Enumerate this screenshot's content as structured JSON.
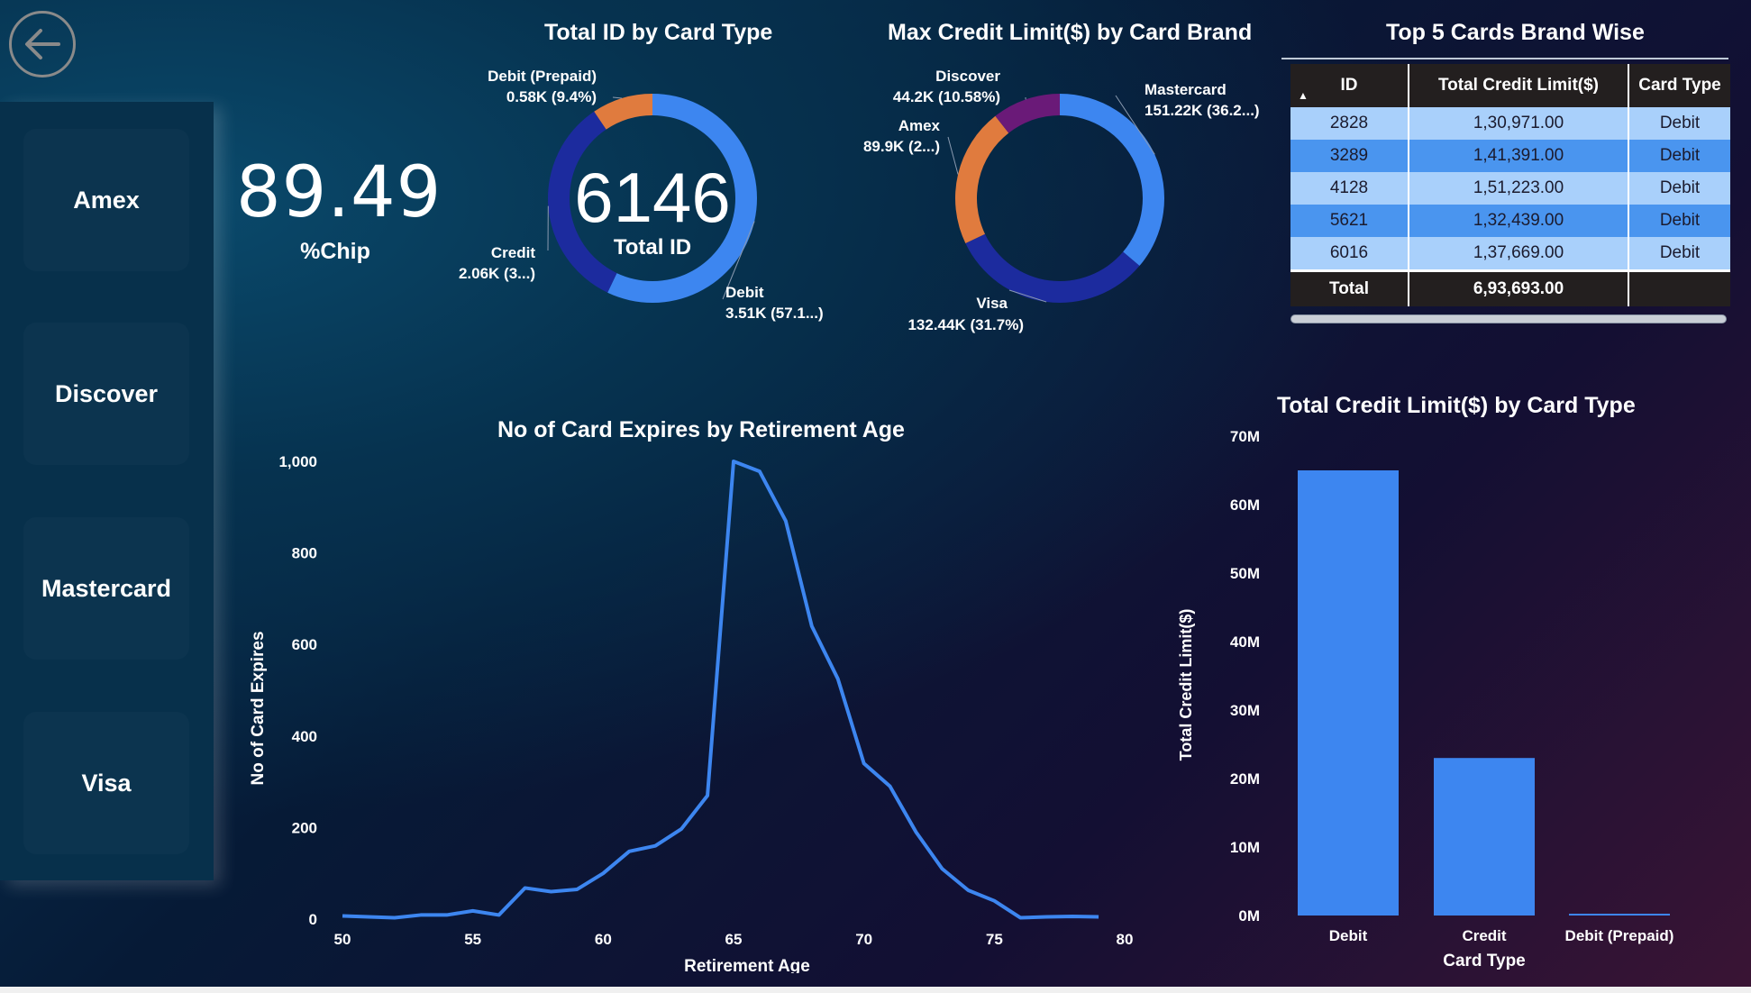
{
  "nav": {
    "back_label": "Back"
  },
  "slicer": {
    "items": [
      "Amex",
      "Discover",
      "Mastercard",
      "Visa"
    ]
  },
  "kpi": {
    "value": "89.49",
    "label": "%Chip"
  },
  "donut_card_type": {
    "title": "Total ID by Card Type",
    "center_value": "6146",
    "center_label": "Total ID",
    "labels": [
      {
        "line1": "Debit (Prepaid)",
        "line2": "0.58K (9.4%)"
      },
      {
        "line1": "Credit",
        "line2": "2.06K (3...)"
      },
      {
        "line1": "Debit",
        "line2": "3.51K (57.1...)"
      }
    ]
  },
  "donut_card_brand": {
    "title": "Max Credit Limit($) by Card Brand",
    "labels": [
      {
        "line1": "Discover",
        "line2": "44.2K (10.58%)"
      },
      {
        "line1": "Amex",
        "line2": "89.9K (2...)"
      },
      {
        "line1": "Mastercard",
        "line2": "151.22K (36.2...)"
      },
      {
        "line1": "Visa",
        "line2": "132.44K (31.7%)"
      }
    ]
  },
  "table": {
    "title": "Top 5 Cards Brand Wise",
    "columns": [
      "ID",
      "Total Credit Limit($)",
      "Card Type"
    ],
    "rows": [
      [
        "2828",
        "1,30,971.00",
        "Debit"
      ],
      [
        "3289",
        "1,41,391.00",
        "Debit"
      ],
      [
        "4128",
        "1,51,223.00",
        "Debit"
      ],
      [
        "5621",
        "1,32,439.00",
        "Debit"
      ],
      [
        "6016",
        "1,37,669.00",
        "Debit"
      ]
    ],
    "total": [
      "Total",
      "6,93,693.00",
      ""
    ]
  },
  "line_chart": {
    "title": "No of Card Expires by Retirement Age",
    "ticks_x": [
      "50",
      "55",
      "60",
      "65",
      "70",
      "75",
      "80"
    ],
    "ticks_y": [
      "0",
      "200",
      "400",
      "600",
      "800",
      "1,000"
    ]
  },
  "bar_chart": {
    "title": "Total Credit Limit($) by Card Type",
    "ticks_y": [
      "0M",
      "10M",
      "20M",
      "30M",
      "40M",
      "50M",
      "60M",
      "70M"
    ]
  },
  "colors": {
    "debit": "#3d86f0",
    "credit": "#1c2b9e",
    "prepaid": "#e07b3e",
    "discover": "#6a1a78",
    "amex": "#e07b3e",
    "mastercard": "#3d86f0",
    "visa": "#1c2b9e"
  },
  "chart_data": [
    {
      "type": "pie",
      "title": "Total ID by Card Type",
      "categories": [
        "Debit",
        "Credit",
        "Debit (Prepaid)"
      ],
      "values": [
        3510,
        2060,
        580
      ]
    },
    {
      "type": "pie",
      "title": "Max Credit Limit($) by Card Brand",
      "categories": [
        "Mastercard",
        "Visa",
        "Amex",
        "Discover"
      ],
      "values": [
        151220,
        132440,
        89900,
        44200
      ]
    },
    {
      "type": "line",
      "title": "No of Card Expires by Retirement Age",
      "xlabel": "Retirement Age",
      "ylabel": "No of Card Expires",
      "x": [
        50,
        51,
        52,
        53,
        54,
        55,
        56,
        57,
        58,
        59,
        60,
        61,
        62,
        63,
        64,
        65,
        66,
        67,
        68,
        69,
        70,
        71,
        72,
        73,
        74,
        75,
        76,
        77,
        78,
        79
      ],
      "y": [
        7,
        5,
        3,
        9,
        9,
        18,
        9,
        68,
        60,
        65,
        100,
        148,
        160,
        197,
        270,
        1000,
        978,
        870,
        640,
        525,
        340,
        290,
        190,
        110,
        63,
        40,
        3,
        5,
        6,
        5
      ],
      "xlim": [
        50,
        80
      ],
      "ylim": [
        0,
        1000
      ]
    },
    {
      "type": "bar",
      "title": "Total Credit Limit($) by Card Type",
      "xlabel": "Card Type",
      "ylabel": "Total Credit Limit($)",
      "categories": [
        "Debit",
        "Credit",
        "Debit (Prepaid)"
      ],
      "values": [
        65000000,
        23000000,
        200000
      ],
      "ylim": [
        0,
        70000000
      ]
    }
  ]
}
